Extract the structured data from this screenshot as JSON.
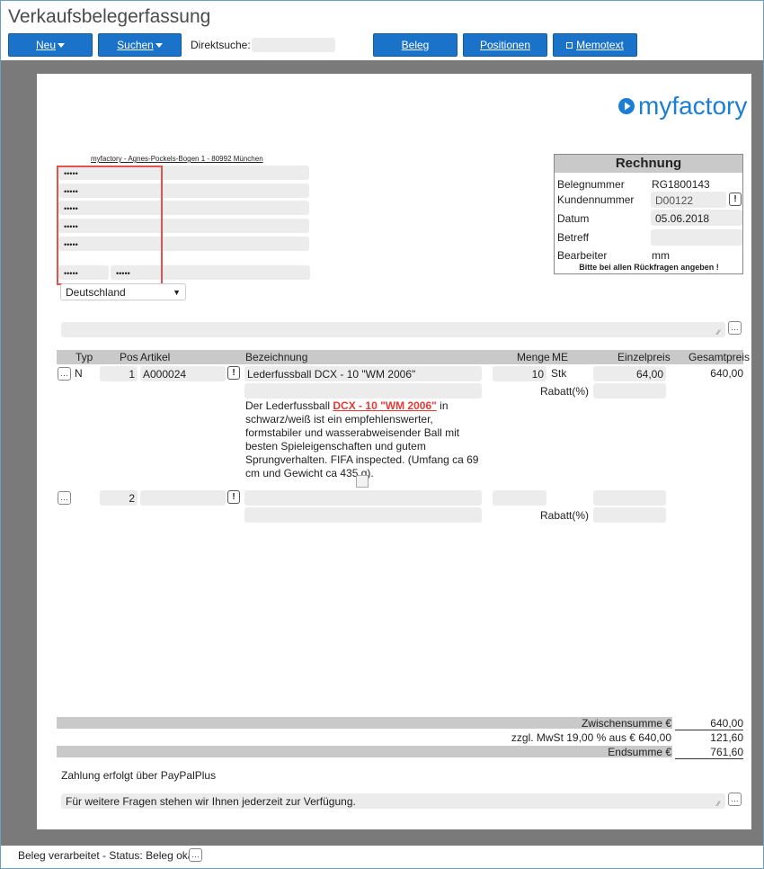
{
  "window": {
    "title": "Verkaufsbelegerfassung"
  },
  "toolbar": {
    "new_label": "Neu",
    "search_label": "Suchen",
    "direct_search_label": "Direktsuche:",
    "direct_search_value": "",
    "beleg_label": "Beleg",
    "positions_label": "Positionen",
    "memo_label": "Memotext"
  },
  "logo": {
    "text": "myfactory",
    "color": "#1a7fd4"
  },
  "address": {
    "sender_line": "myfactory - Agnes-Pockels-Bogen 1 - 80992 München",
    "lines": [
      "•••••",
      "•••••",
      "•••••",
      "•••••",
      "•••••"
    ],
    "zip": "•••••",
    "city": "•••••",
    "country": "Deutschland"
  },
  "invoice_box": {
    "title": "Rechnung",
    "belegnummer_label": "Belegnummer",
    "belegnummer": "RG1800143",
    "kunden_label": "Kundennummer",
    "kunden": "D00122",
    "datum_label": "Datum",
    "datum": "05.06.2018",
    "betreff_label": "Betreff",
    "betreff": "",
    "bearbeiter_label": "Bearbeiter",
    "bearbeiter": "mm",
    "note": "Bitte bei allen Rückfragen angeben !"
  },
  "table": {
    "headers": {
      "typ": "Typ",
      "pos": "Pos",
      "artikel": "Artikel",
      "bez": "Bezeichnung",
      "menge": "Menge",
      "me": "ME",
      "einzel": "Einzelpreis",
      "gesamt": "Gesamtpreis"
    },
    "row1": {
      "typ": "N",
      "pos": "1",
      "artikel": "A000024",
      "bez": "Lederfussball DCX - 10 \"WM 2006\"",
      "menge": "10",
      "me": "Stk",
      "einzel": "64,00",
      "gesamt": "640,00",
      "rabatt_label": "Rabatt(%)",
      "desc_before": "Der Lederfussball ",
      "desc_link": "DCX - 10 \"WM 2006\"",
      "desc_after": " in schwarz/weiß ist ein empfehlenswerter, formstabiler und wasserabweisender Ball mit besten Spieleigenschaften und gutem Sprungverhalten. FIFA inspected. (Umfang ca 69 cm und Gewicht ca 435 g)."
    },
    "row2": {
      "pos": "2",
      "rabatt_label": "Rabatt(%)"
    }
  },
  "totals": {
    "zwischen_label": "Zwischensumme €",
    "zwischen": "640,00",
    "mwst_label": "zzgl. MwSt 19,00 % aus € 640,00",
    "mwst": "121,60",
    "end_label": "Endsumme €",
    "end": "761,60"
  },
  "footer": {
    "payment": "Zahlung erfolgt über PayPalPlus",
    "closing": "Für weitere Fragen stehen wir Ihnen jederzeit zur Verfügung."
  },
  "status": {
    "text": "Beleg verarbeitet - Status: Beleg okay"
  }
}
